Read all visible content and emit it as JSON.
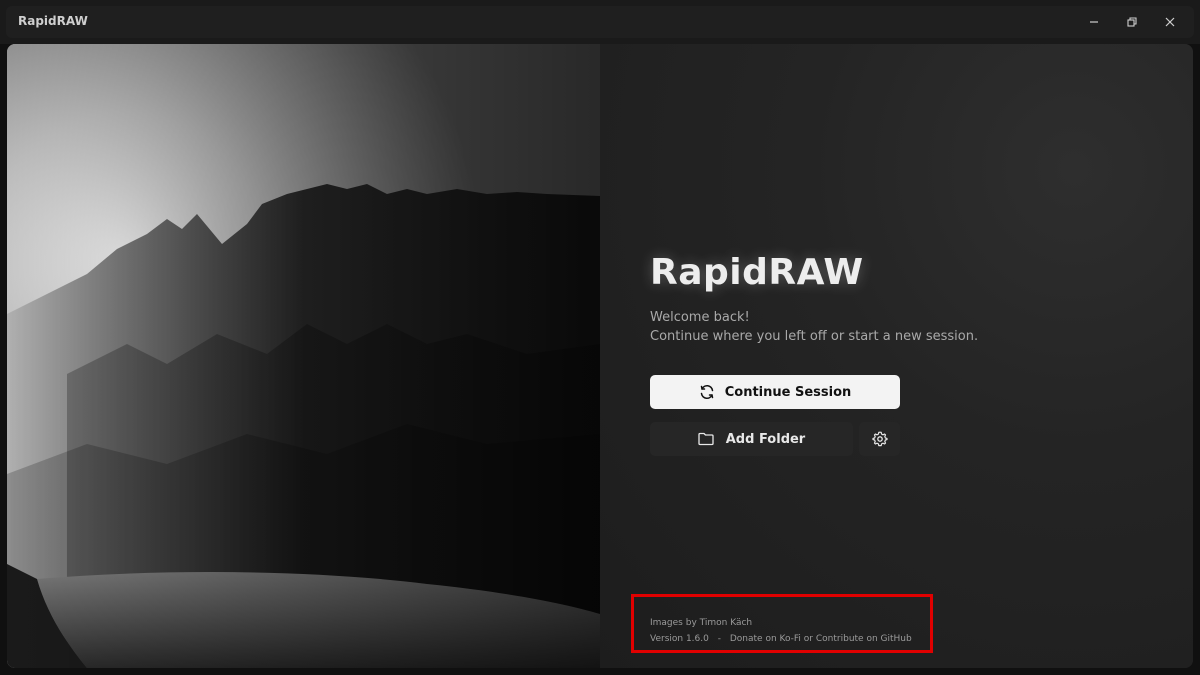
{
  "window": {
    "title": "RapidRAW"
  },
  "welcome": {
    "brand": "RapidRAW",
    "greeting": "Welcome back!",
    "subtitle": "Continue where you left off or start a new session.",
    "continue_label": "Continue Session",
    "add_folder_label": "Add Folder"
  },
  "footer": {
    "credit": "Images by Timon Käch",
    "version": "Version 1.6.0",
    "separator": "-",
    "donate": "Donate on Ko-Fi",
    "or": "or",
    "contribute": "Contribute on GitHub"
  },
  "colors": {
    "highlight": "#e00000",
    "panel_bg": "#1d1d1d",
    "primary_button": "#f3f3f3"
  },
  "icons": {
    "continue": "refresh-icon",
    "add_folder": "folder-icon",
    "settings": "gear-icon"
  }
}
